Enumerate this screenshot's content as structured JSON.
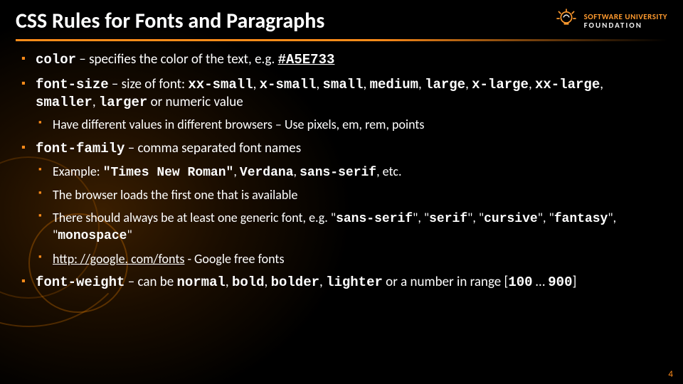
{
  "header": {
    "title": "CSS Rules for Fonts and Paragraphs",
    "logo_top": "SOFTWARE UNIVERSITY",
    "logo_bottom": "FOUNDATION"
  },
  "bullets": {
    "b1_code": "color",
    "b1_text": " – specifies the color of the text, e.g. ",
    "b1_ex": "#A5E733",
    "b2_code": "font-size",
    "b2_text1": " – size of font: ",
    "b2_v1": "xx-small",
    "b2_s1": ", ",
    "b2_v2": "x-small",
    "b2_s2": ", ",
    "b2_v3": "small",
    "b2_s3": ", ",
    "b2_v4": "medium",
    "b2_s4": ", ",
    "b2_v5": "large",
    "b2_s5": ", ",
    "b2_v6": "x-large",
    "b2_s6": ", ",
    "b2_v7": "xx-large",
    "b2_s7": ", ",
    "b2_v8": "smaller",
    "b2_s8": ", ",
    "b2_v9": "larger",
    "b2_text2": " or numeric value",
    "b2_sub1": "Have different values in different browsers – Use pixels, em, rem, points",
    "b3_code": "font-family",
    "b3_text": " – comma separated font names",
    "b3_sub1_a": "Example: ",
    "b3_sub1_b": "\"Times New Roman\"",
    "b3_sub1_c": ", ",
    "b3_sub1_d": "Verdana",
    "b3_sub1_e": ", ",
    "b3_sub1_f": "sans-serif",
    "b3_sub1_g": ", etc.",
    "b3_sub2": "The browser loads the first one that is available",
    "b3_sub3_a": "There should always be at least one generic font, e.g. \"",
    "b3_sub3_b": "sans-serif",
    "b3_sub3_c": "\", \"",
    "b3_sub3_d": "serif",
    "b3_sub3_e": "\", \"",
    "b3_sub3_f": "cursive",
    "b3_sub3_g": "\", \"",
    "b3_sub3_h": "fantasy",
    "b3_sub3_i": "\", \"",
    "b3_sub3_j": "monospace",
    "b3_sub3_k": "\"",
    "b3_sub4_a": "http: //google. com/fonts",
    "b3_sub4_b": " - Google free fonts",
    "b4_code": "font-weight",
    "b4_a": " – can be ",
    "b4_v1": "normal",
    "b4_s1": ", ",
    "b4_v2": "bold",
    "b4_s2": ", ",
    "b4_v3": "bolder",
    "b4_s3": ", ",
    "b4_v4": "lighter",
    "b4_b": " or a number in range [",
    "b4_v5": "100",
    "b4_c": " … ",
    "b4_v6": "900",
    "b4_d": "]"
  },
  "page_number": "4"
}
